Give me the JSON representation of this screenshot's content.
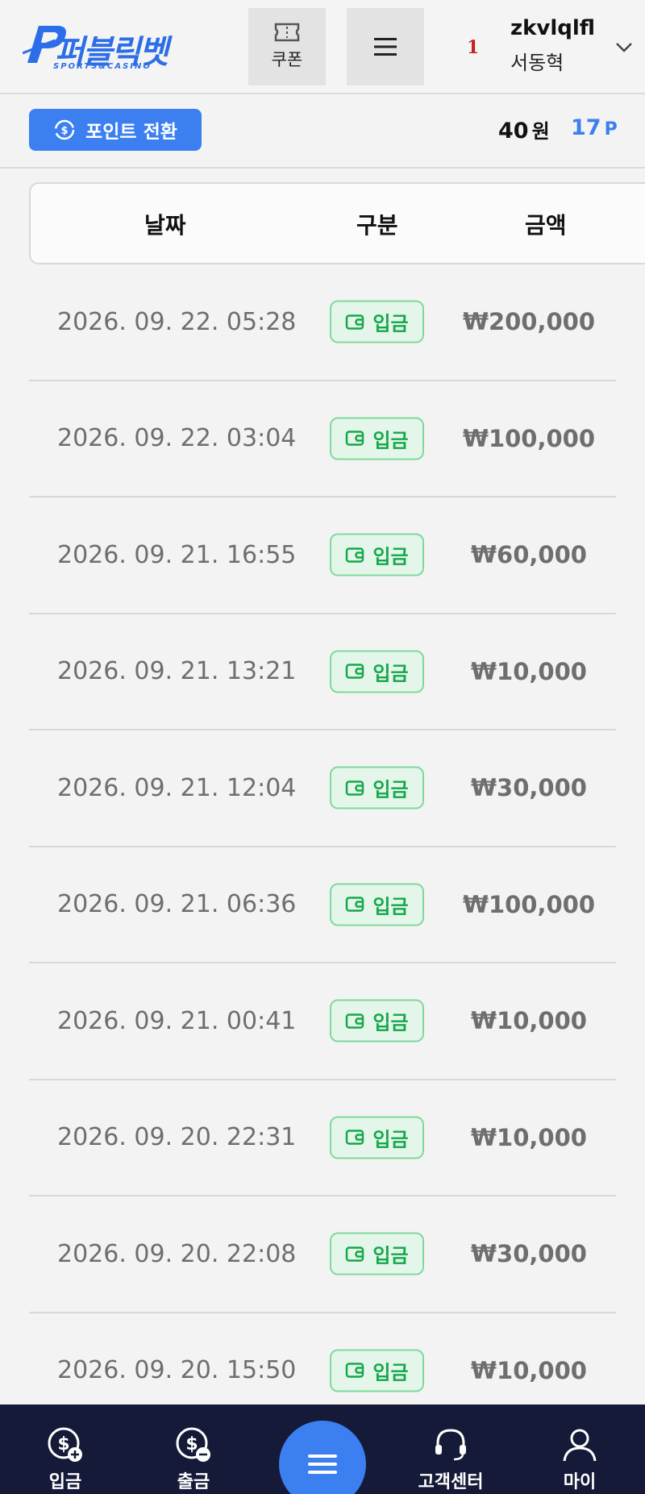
{
  "header": {
    "logo_text": "퍼블릭벳",
    "logo_sub": "SPORTS&CASINO",
    "coupon_label": "쿠폰",
    "user": {
      "level": "1",
      "username": "zkvlqlfl",
      "realname": "서동혁"
    }
  },
  "pointbar": {
    "convert_label": "포인트 전환",
    "balance": "40",
    "balance_unit": "원",
    "points": "17",
    "points_unit": "P"
  },
  "table": {
    "headers": {
      "date": "날짜",
      "type": "구분",
      "amount": "금액"
    },
    "rows": [
      {
        "date": "2026. 09. 22. 05:28",
        "type": "입금",
        "amount": "₩200,000"
      },
      {
        "date": "2026. 09. 22. 03:04",
        "type": "입금",
        "amount": "₩100,000"
      },
      {
        "date": "2026. 09. 21. 16:55",
        "type": "입금",
        "amount": "₩60,000"
      },
      {
        "date": "2026. 09. 21. 13:21",
        "type": "입금",
        "amount": "₩10,000"
      },
      {
        "date": "2026. 09. 21. 12:04",
        "type": "입금",
        "amount": "₩30,000"
      },
      {
        "date": "2026. 09. 21. 06:36",
        "type": "입금",
        "amount": "₩100,000"
      },
      {
        "date": "2026. 09. 21. 00:41",
        "type": "입금",
        "amount": "₩10,000"
      },
      {
        "date": "2026. 09. 20. 22:31",
        "type": "입금",
        "amount": "₩10,000"
      },
      {
        "date": "2026. 09. 20. 22:08",
        "type": "입금",
        "amount": "₩30,000"
      },
      {
        "date": "2026. 09. 20. 15:50",
        "type": "입금",
        "amount": "₩10,000"
      }
    ]
  },
  "nav": {
    "deposit": "입금",
    "withdraw": "출금",
    "support": "고객센터",
    "my": "마이"
  },
  "colors": {
    "accent": "#3b7ff0",
    "deposit_green": "#15a84a",
    "nav_bg": "#151a38",
    "level_red": "#c62020"
  }
}
